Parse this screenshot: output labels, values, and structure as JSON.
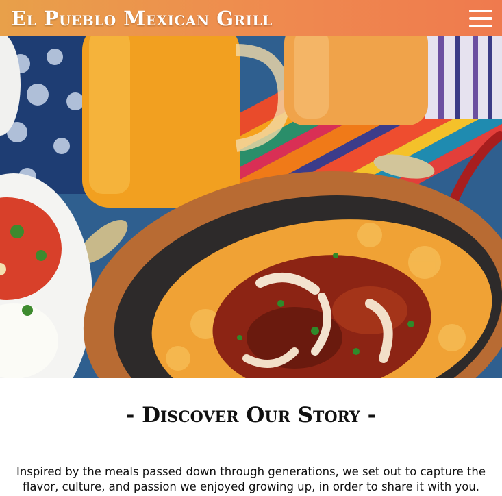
{
  "header": {
    "brand": "El Pueblo Mexican Grill",
    "menu_icon": "hamburger-menu-icon",
    "gradient_colors": [
      "#e8a04a",
      "#ef7a4e"
    ]
  },
  "hero": {
    "image_description_icon": "food-photo"
  },
  "story": {
    "title": "- Discover Our Story -",
    "text": "Inspired by the meals passed down through generations, we set out to capture the flavor, culture, and passion we enjoyed growing up, in order to share it with you."
  }
}
